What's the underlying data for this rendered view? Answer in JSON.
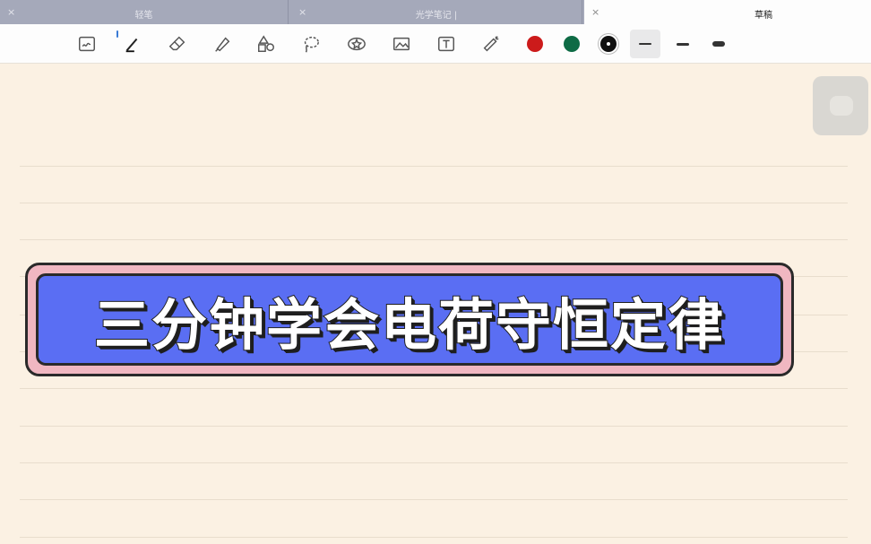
{
  "tabs": [
    {
      "label": "轻笔",
      "close": "×",
      "active": false
    },
    {
      "label": "光学笔记 |",
      "close": "×",
      "active": false
    },
    {
      "label": "草稿",
      "close": "×",
      "active": true
    }
  ],
  "toolbar": {
    "tools": [
      "document-scan-icon",
      "pen-icon",
      "eraser-icon",
      "highlighter-icon",
      "shapes-icon",
      "lasso-icon",
      "sticker-icon",
      "image-icon",
      "text-box-icon",
      "laser-pointer-icon"
    ],
    "colors": [
      "#cc1b1b",
      "#0e6b45",
      "#111111"
    ],
    "selected_color": "#111111",
    "stroke_widths": [
      "thin",
      "medium",
      "thick"
    ],
    "selected_stroke": "thin"
  },
  "banner": {
    "title": "三分钟学会电荷守恒定律",
    "fill_color": "#5a6ef3",
    "border_color": "#f0b7c1"
  }
}
